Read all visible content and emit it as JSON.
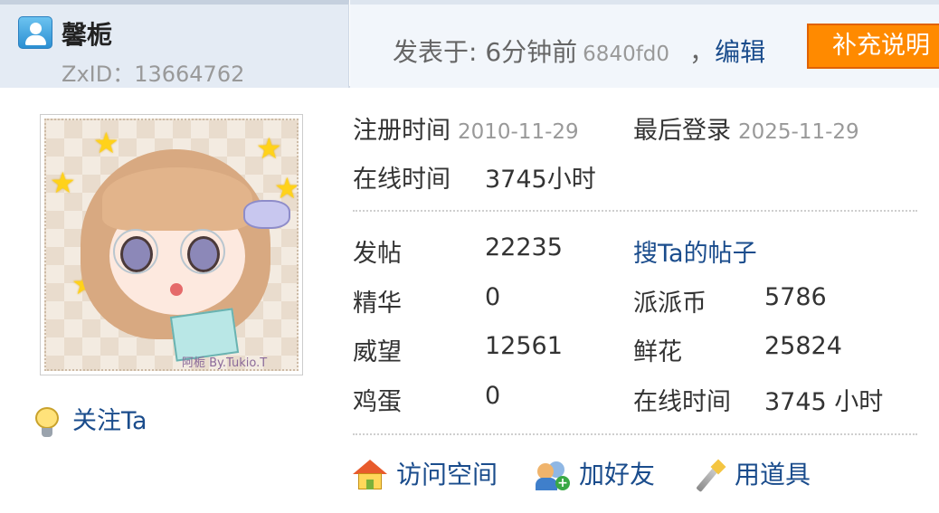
{
  "user": {
    "name": "馨栀",
    "zxid_label": "ZxID：",
    "zxid": "13664762"
  },
  "post": {
    "posted_label": "发表于: ",
    "time": "6分钟前",
    "hash": "6840fd0",
    "comma": "，",
    "edit_label": "编辑",
    "supplement_label": "补充说明"
  },
  "avatar": {
    "signature": "阿栀 By.Tukio.T"
  },
  "follow": {
    "label": "关注Ta"
  },
  "info": {
    "reg_label": "注册时间",
    "reg_value": "2010-11-29",
    "last_label": "最后登录",
    "last_value": "2025-11-29",
    "online_label": "在线时间",
    "online_value": "3745小时"
  },
  "stats": {
    "posts_label": "发帖",
    "posts_value": "22235",
    "search_posts_label": "搜Ta的帖子",
    "digest_label": "精华",
    "digest_value": "0",
    "coin_label": "派派币",
    "coin_value": "5786",
    "prestige_label": "威望",
    "prestige_value": "12561",
    "flower_label": "鲜花",
    "flower_value": "25824",
    "egg_label": "鸡蛋",
    "egg_value": "0",
    "online_label": "在线时间",
    "online_value": "3745 小时"
  },
  "actions": {
    "visit_label": "访问空间",
    "add_friend_label": "加好友",
    "use_tool_label": "用道具"
  },
  "colors": {
    "link": "#1a4c8c",
    "accent_button": "#ff8a00",
    "header_left_bg": "#e4ebf4",
    "header_right_bg": "#f2f6fb"
  },
  "icons": [
    "user-card-icon",
    "lightbulb-icon",
    "house-icon",
    "friends-add-icon",
    "magic-wand-icon"
  ]
}
